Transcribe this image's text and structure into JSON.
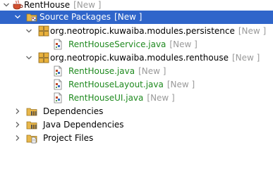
{
  "tree": {
    "project": {
      "name": "RentHouse",
      "badge": "[New ]",
      "icon": "coffee-cup-project-icon"
    },
    "source_packages": {
      "name": "Source Packages",
      "badge": "[New ]",
      "icon": "source-folder-icon"
    },
    "packages": [
      {
        "name": "org.neotropic.kuwaiba.modules.persistence",
        "badge": "[New ]",
        "icon": "package-icon",
        "files": [
          {
            "name": "RentHouseService.java",
            "badge": "[New ]",
            "icon": "java-file-icon"
          }
        ]
      },
      {
        "name": "org.neotropic.kuwaiba.modules.renthouse",
        "badge": "[New ]",
        "icon": "package-icon",
        "files": [
          {
            "name": "RentHouse.java",
            "badge": "[New ]",
            "icon": "java-file-icon"
          },
          {
            "name": "RentHouseLayout.java",
            "badge": "[New ]",
            "icon": "java-file-icon"
          },
          {
            "name": "RentHouseUI.java",
            "badge": "[New ]",
            "icon": "java-file-icon"
          }
        ]
      }
    ],
    "nodes": [
      {
        "name": "Dependencies",
        "icon": "library-folder-icon"
      },
      {
        "name": "Java Dependencies",
        "icon": "library-folder-icon"
      },
      {
        "name": "Project Files",
        "icon": "project-files-folder-icon"
      }
    ]
  },
  "colors": {
    "selection": "#2f65ca",
    "java_text": "#1f8a1f",
    "badge_text": "#9a9a9a"
  }
}
